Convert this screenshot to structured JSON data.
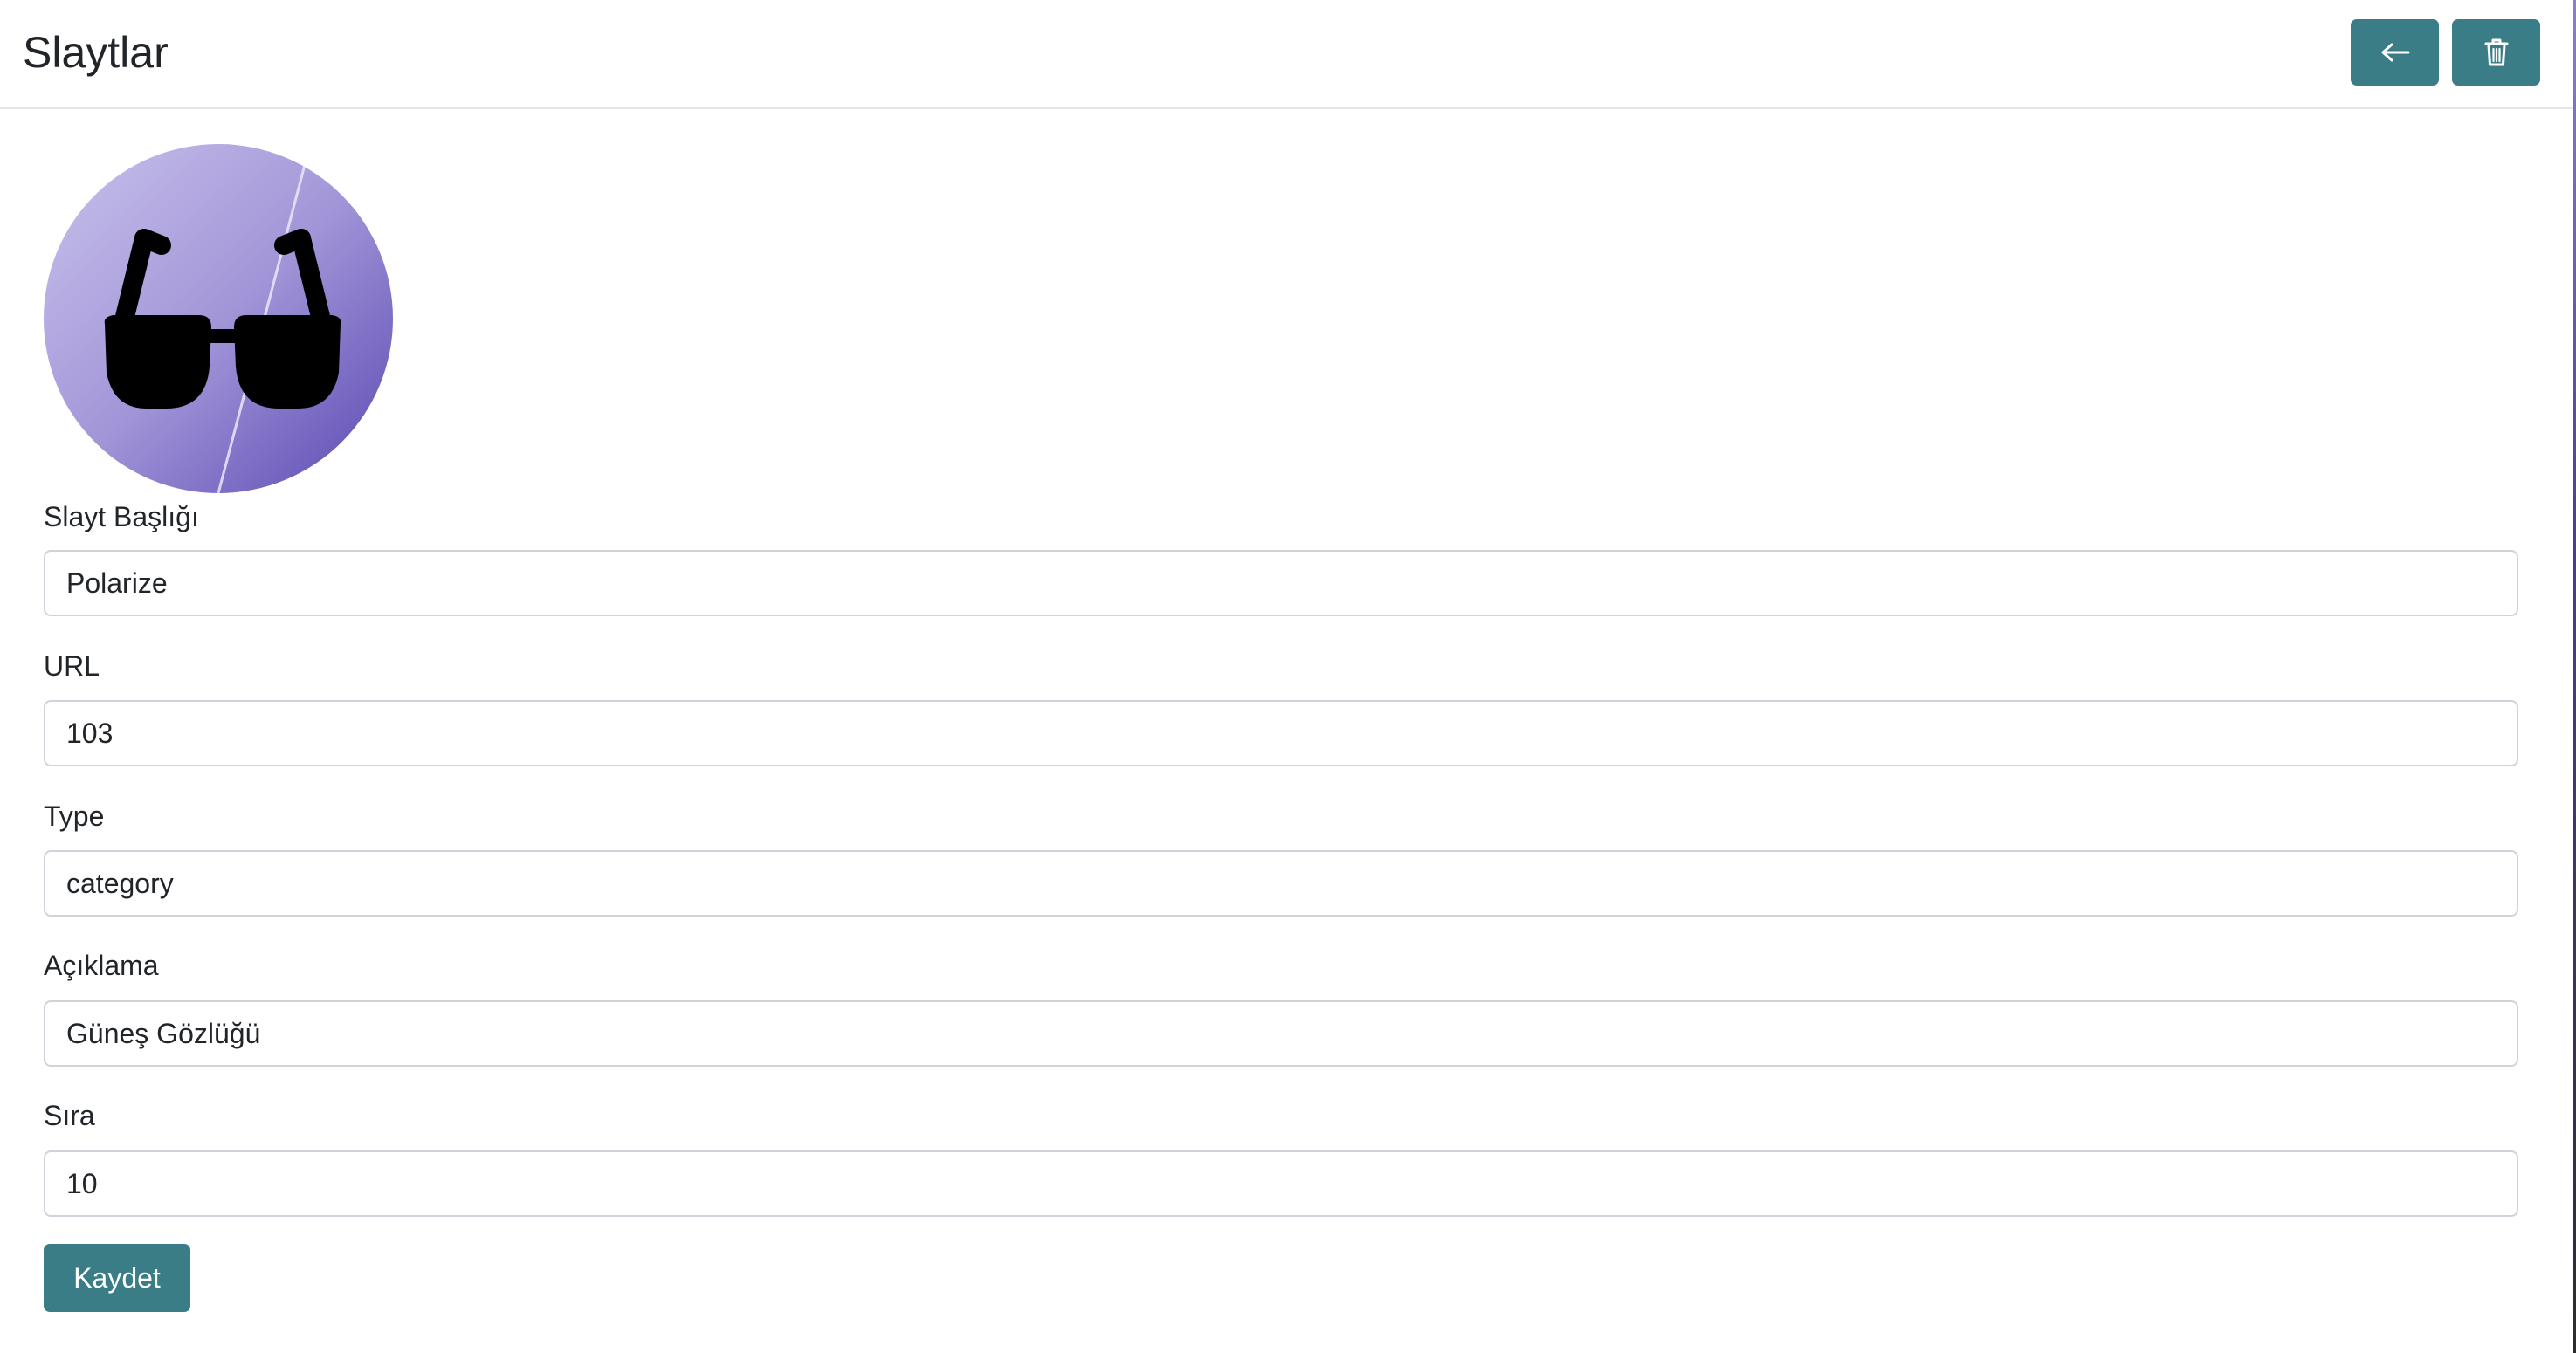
{
  "header": {
    "title": "Slaytlar",
    "back_icon": "arrow-left-icon",
    "delete_icon": "trash-icon",
    "button_color": "#3a7d87"
  },
  "slide_image": {
    "icon": "sunglasses-icon",
    "gradient_from": "#c3bbe8",
    "gradient_to": "#5a48b3"
  },
  "form": {
    "fields": [
      {
        "label": "Slayt Başlığı",
        "value": "Polarize"
      },
      {
        "label": "URL",
        "value": "103"
      },
      {
        "label": "Type",
        "value": "category"
      },
      {
        "label": "Açıklama",
        "value": "Güneş Gözlüğü"
      },
      {
        "label": "Sıra",
        "value": "10"
      }
    ],
    "save_label": "Kaydet"
  }
}
